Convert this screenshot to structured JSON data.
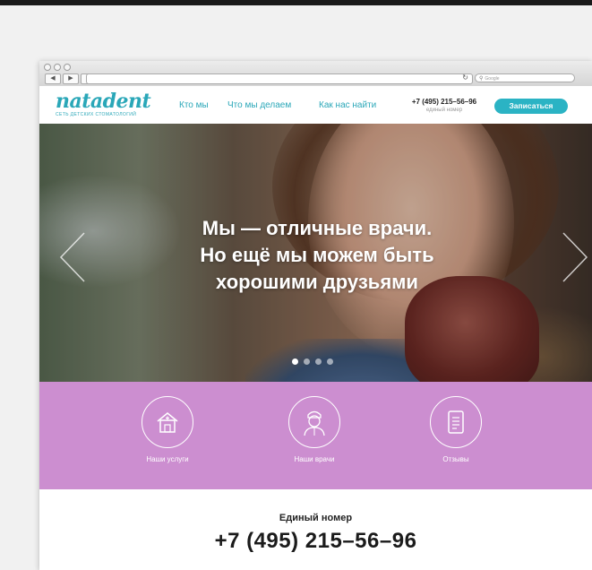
{
  "browser": {
    "search_placeholder": "Google",
    "back_label": "◀",
    "forward_label": "▶",
    "add_label": "+"
  },
  "header": {
    "logo_text": "natadent",
    "logo_subtitle": "СЕТЬ ДЕТСКИХ СТОМАТОЛОГИЙ",
    "nav": [
      "Кто мы",
      "Что мы делаем",
      "Как нас найти"
    ],
    "phone": "+7 (495) 215–56–96",
    "phone_caption": "единый номер",
    "signup_label": "Записаться"
  },
  "hero": {
    "title_lines": [
      "Мы — отличные врачи.",
      "Но ещё мы можем быть",
      "хорошими друзьями"
    ],
    "slides_count": 4,
    "active_slide": 1
  },
  "services": [
    {
      "label": "Наши услуги",
      "icon": "clinic-house-icon"
    },
    {
      "label": "Наши врачи",
      "icon": "nurse-icon"
    },
    {
      "label": "Отзывы",
      "icon": "reviews-document-icon"
    }
  ],
  "contact": {
    "title": "Единый номер",
    "phone": "+7 (495) 215–56–96"
  },
  "colors": {
    "accent": "#2aa7b8",
    "button": "#2bb3c4",
    "band": "#cc8ed0"
  }
}
